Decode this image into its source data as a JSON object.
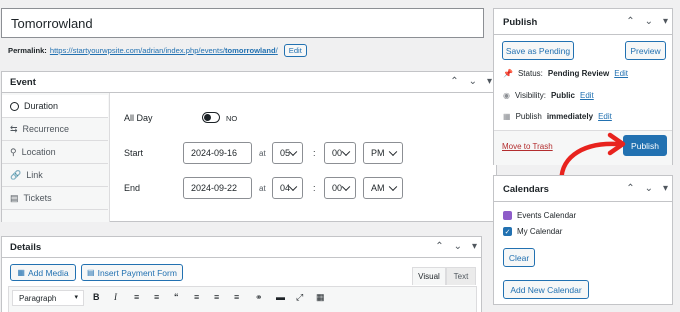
{
  "title_field": {
    "value": "Tomorrowland"
  },
  "permalink": {
    "label": "Permalink:",
    "url_prefix": "https://startyourwpsite.com/adrian/index.php/events/",
    "slug": "tomorrowland",
    "url_suffix": "/",
    "edit": "Edit"
  },
  "event_box": {
    "title": "Event",
    "tabs": [
      {
        "label": "Duration",
        "icon": "clock-icon"
      },
      {
        "label": "Recurrence",
        "icon": "recurrence-icon"
      },
      {
        "label": "Location",
        "icon": "location-pin-icon"
      },
      {
        "label": "Link",
        "icon": "link-icon"
      },
      {
        "label": "Tickets",
        "icon": "tickets-icon"
      }
    ],
    "all_day_label": "All Day",
    "all_day_toggle": "NO",
    "start": {
      "label": "Start",
      "date": "2024-09-16",
      "at": "at",
      "hour": "05",
      "sep": ":",
      "minute": "00",
      "ampm": "PM"
    },
    "end": {
      "label": "End",
      "date": "2024-09-22",
      "at": "at",
      "hour": "04",
      "sep": ":",
      "minute": "00",
      "ampm": "AM"
    }
  },
  "details_box": {
    "title": "Details",
    "add_media": "Add Media",
    "insert_payment_form": "Insert Payment Form",
    "tab_visual": "Visual",
    "tab_text": "Text",
    "format_select": "Paragraph"
  },
  "publish_box": {
    "title": "Publish",
    "save_pending": "Save as Pending",
    "preview": "Preview",
    "status_label": "Status:",
    "status_value": "Pending Review",
    "visibility_label": "Visibility:",
    "visibility_value": "Public",
    "publish_label": "Publish",
    "publish_value": "immediately",
    "edit": "Edit",
    "move_to_trash": "Move to Trash",
    "publish_button": "Publish"
  },
  "calendars_box": {
    "title": "Calendars",
    "items": [
      {
        "label": "Events Calendar",
        "checked": false,
        "color": "#8e5cc9"
      },
      {
        "label": "My Calendar",
        "checked": true,
        "color": "#2271b1"
      }
    ],
    "clear": "Clear",
    "add_new": "Add New Calendar"
  },
  "colors": {
    "accent": "#2271b1",
    "danger": "#b32d2e",
    "arrow": "#e8231e"
  }
}
